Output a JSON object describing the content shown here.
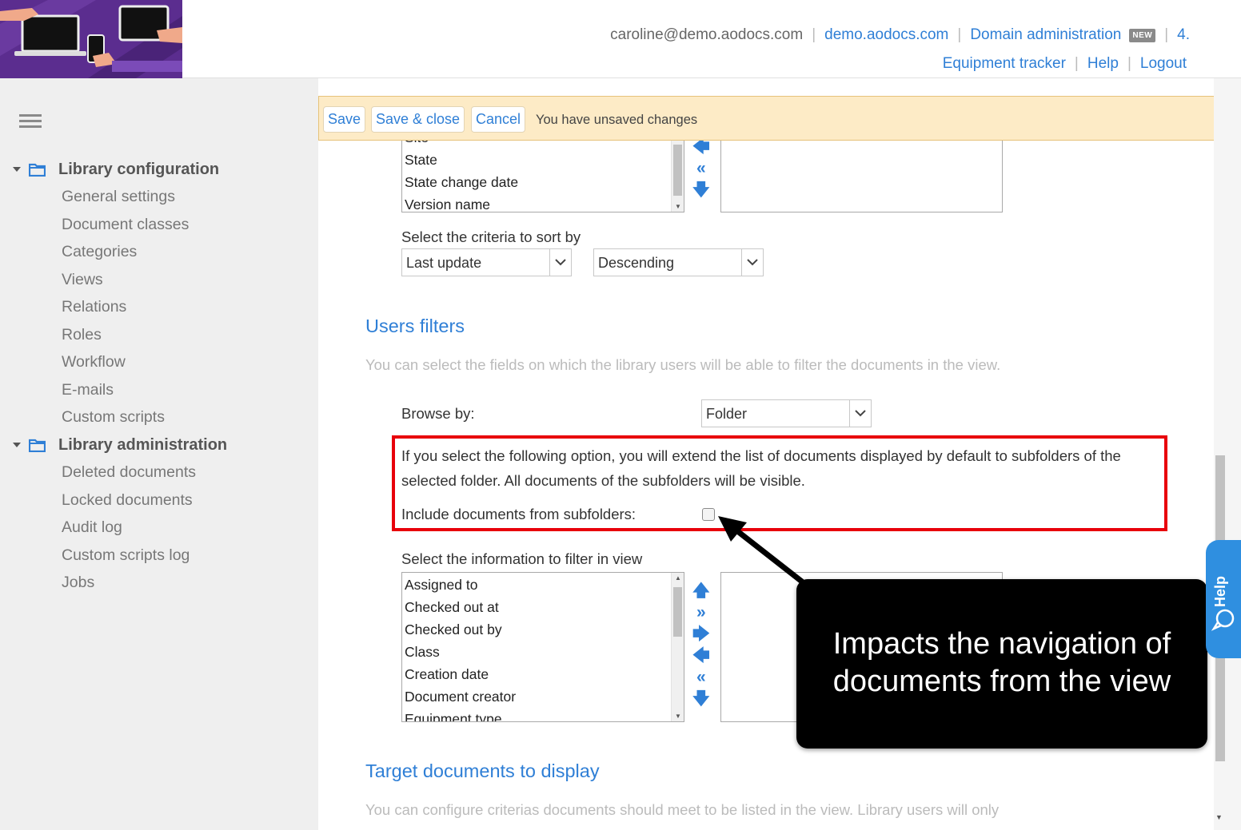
{
  "header": {
    "email": "caroline@demo.aodocs.com",
    "domain": "demo.aodocs.com",
    "domain_admin": "Domain administration",
    "new_badge": "NEW",
    "version": "4.",
    "equipment_tracker": "Equipment tracker",
    "help": "Help",
    "logout": "Logout",
    "sep": "|"
  },
  "sidebar": {
    "config_title": "Library configuration",
    "config_items": [
      "General settings",
      "Document classes",
      "Categories",
      "Views",
      "Relations",
      "Roles",
      "Workflow",
      "E-mails",
      "Custom scripts"
    ],
    "admin_title": "Library administration",
    "admin_items": [
      "Deleted documents",
      "Locked documents",
      "Audit log",
      "Custom scripts log",
      "Jobs"
    ]
  },
  "toolbar": {
    "save": "Save",
    "save_close": "Save & close",
    "cancel": "Cancel",
    "message": "You have unsaved changes"
  },
  "columns_list": {
    "items": [
      "Site",
      "State",
      "State change date",
      "Version name"
    ]
  },
  "sort": {
    "label": "Select the criteria to sort by",
    "field": "Last update",
    "order": "Descending"
  },
  "users_filters": {
    "heading": "Users filters",
    "description": "You can select the fields on which the library users will be able to filter the documents in the view.",
    "browse_label": "Browse by:",
    "browse_value": "Folder",
    "info": "If you select the following option, you will extend the list of documents displayed by default to subfolders of the selected folder. All documents of the subfolders will be visible.",
    "include_label": "Include documents from subfolders:",
    "include_checked": false,
    "filter_label": "Select the information to filter in view",
    "filter_items": [
      "Assigned to",
      "Checked out at",
      "Checked out by",
      "Class",
      "Creation date",
      "Document creator",
      "Equipment type"
    ]
  },
  "target": {
    "heading": "Target documents to display",
    "description": "You can configure criterias documents should meet to be listed in the view. Library users will only"
  },
  "callout": {
    "line1": "Impacts the navigation of",
    "line2": "documents from the view"
  },
  "help_tab": {
    "label": "Help"
  },
  "colors": {
    "accent": "#2f7fd6",
    "logo_bg": "#5b2d8f",
    "highlight": "#e8000b",
    "toolbar_bg": "#fdebc6"
  }
}
